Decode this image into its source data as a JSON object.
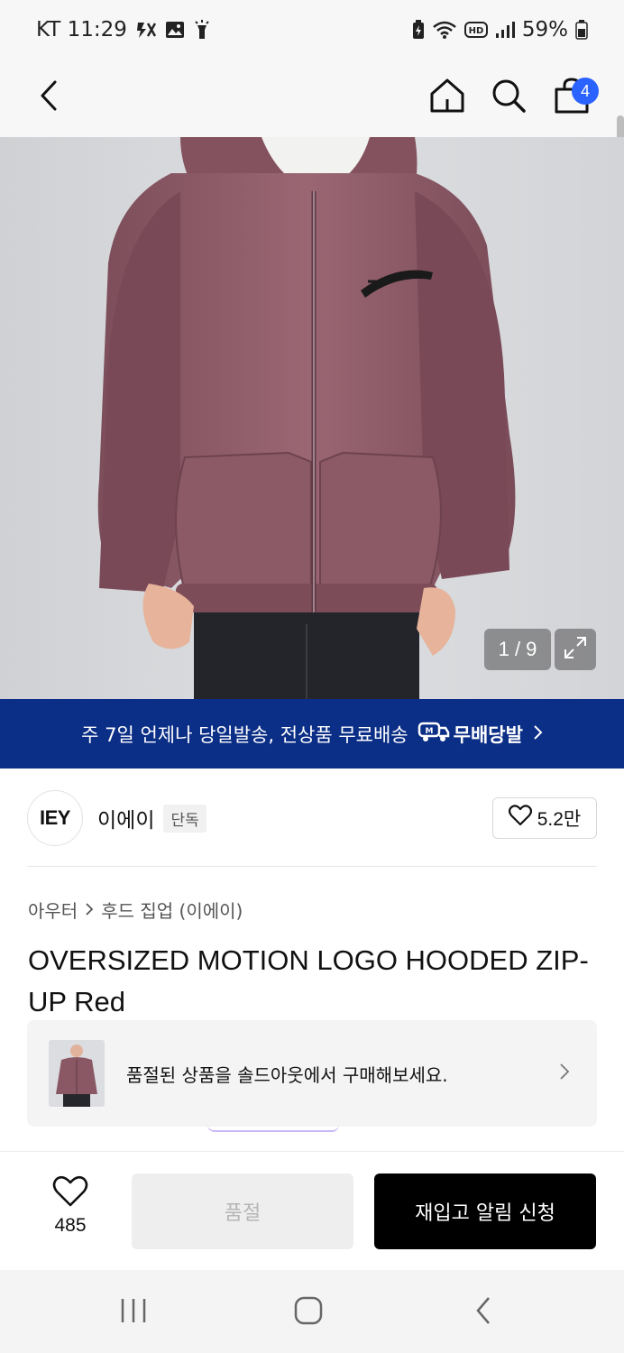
{
  "status_bar": {
    "carrier_time": "KT 11:29",
    "battery": "59%",
    "icons": [
      "flash-off-icon",
      "gallery-icon",
      "flashlight-icon",
      "battery-saver-icon",
      "wifi-icon",
      "hd-voice-icon",
      "signal-icon",
      "battery-icon"
    ]
  },
  "header": {
    "back_icon": "back-chevron-icon",
    "home_icon": "home-icon",
    "search_icon": "search-icon",
    "cart_icon": "shopping-bag-icon",
    "cart_count": "4"
  },
  "gallery": {
    "counter": "1 / 9",
    "expand_icon": "expand-icon"
  },
  "promo": {
    "text": "주 7일 언제나 당일발송, 전상품 무료배송",
    "logo_text": "무배당발"
  },
  "brand": {
    "logo_text": "IEY",
    "name": "이에이",
    "tag": "단독",
    "likes": "5.2만"
  },
  "breadcrumb": {
    "category": "아우터",
    "subcategory": "후드 집업 (이에이)"
  },
  "product": {
    "title": "OVERSIZED MOTION LOGO HOODED ZIP-UP Red"
  },
  "soldout_card": {
    "text": "품절된 상품을 솔드아웃에서 구매해보세요."
  },
  "bottom_bar": {
    "wish_count": "485",
    "soldout_label": "품절",
    "restock_label": "재입고 알림 신청"
  },
  "colors": {
    "promo_bg": "#0b2e86",
    "badge": "#2a63ff",
    "hoodie": "#8d5a66"
  }
}
